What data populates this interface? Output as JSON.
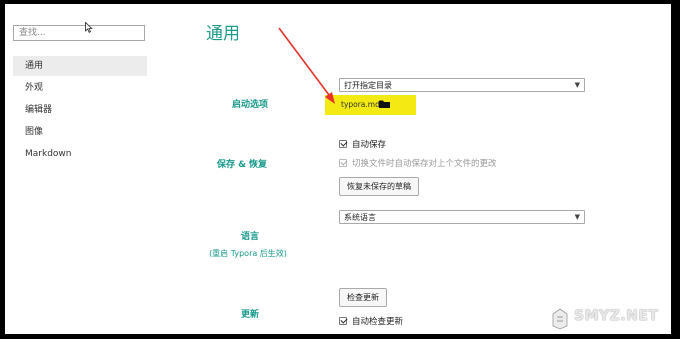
{
  "sidebar": {
    "search_placeholder": "查找...",
    "items": [
      {
        "label": "通用",
        "active": true
      },
      {
        "label": "外观"
      },
      {
        "label": "编辑器"
      },
      {
        "label": "图像"
      },
      {
        "label": "Markdown"
      }
    ]
  },
  "main": {
    "title": "通用",
    "startup": {
      "label": "启动选项",
      "select_value": "打开指定目录",
      "path_text": "typora.md",
      "highlight_color": "#f2ea12"
    },
    "save": {
      "label": "保存 & 恢复",
      "autosave_label": "自动保存",
      "autosave_checked": true,
      "switch_label": "切换文件时自动保存对上个文件的更改",
      "switch_checked": true,
      "recover_button": "恢复未保存的草稿"
    },
    "language": {
      "label": "语言",
      "sublabel": "(重启 Typora 后生效)",
      "select_value": "系统语言"
    },
    "update": {
      "label": "更新",
      "check_button": "检查更新",
      "auto_check_label": "自动检查更新",
      "auto_check_checked": true
    }
  },
  "watermark": {
    "text": "SMYZ.NET"
  },
  "accent_color": "#17998a",
  "annotation_color": "#e8322a"
}
